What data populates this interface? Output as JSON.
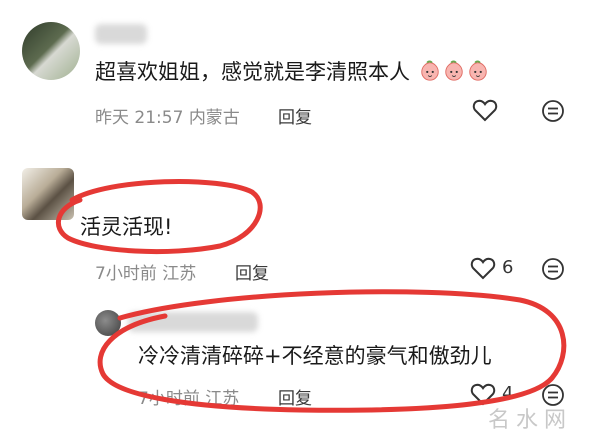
{
  "comments": [
    {
      "text": "超喜欢姐姐，感觉就是李清照本人",
      "emoji_count": 3,
      "time": "昨天 21:57",
      "location": "内蒙古",
      "reply_label": "回复",
      "like_count": ""
    },
    {
      "text": "活灵活现!",
      "time": "7小时前",
      "location": "江苏",
      "reply_label": "回复",
      "like_count": "6"
    },
    {
      "text": "冷冷清清碎碎+不经意的豪气和傲劲儿",
      "time": "7小时前",
      "location": "江苏",
      "reply_label": "回复",
      "like_count": "4"
    }
  ],
  "watermark": "名水网",
  "colors": {
    "highlight": "#e53935",
    "meta": "#8a8a8a"
  },
  "icons": {
    "like": "heart-icon",
    "more": "comment-menu-icon",
    "emoji": "peach-face-emoji"
  }
}
